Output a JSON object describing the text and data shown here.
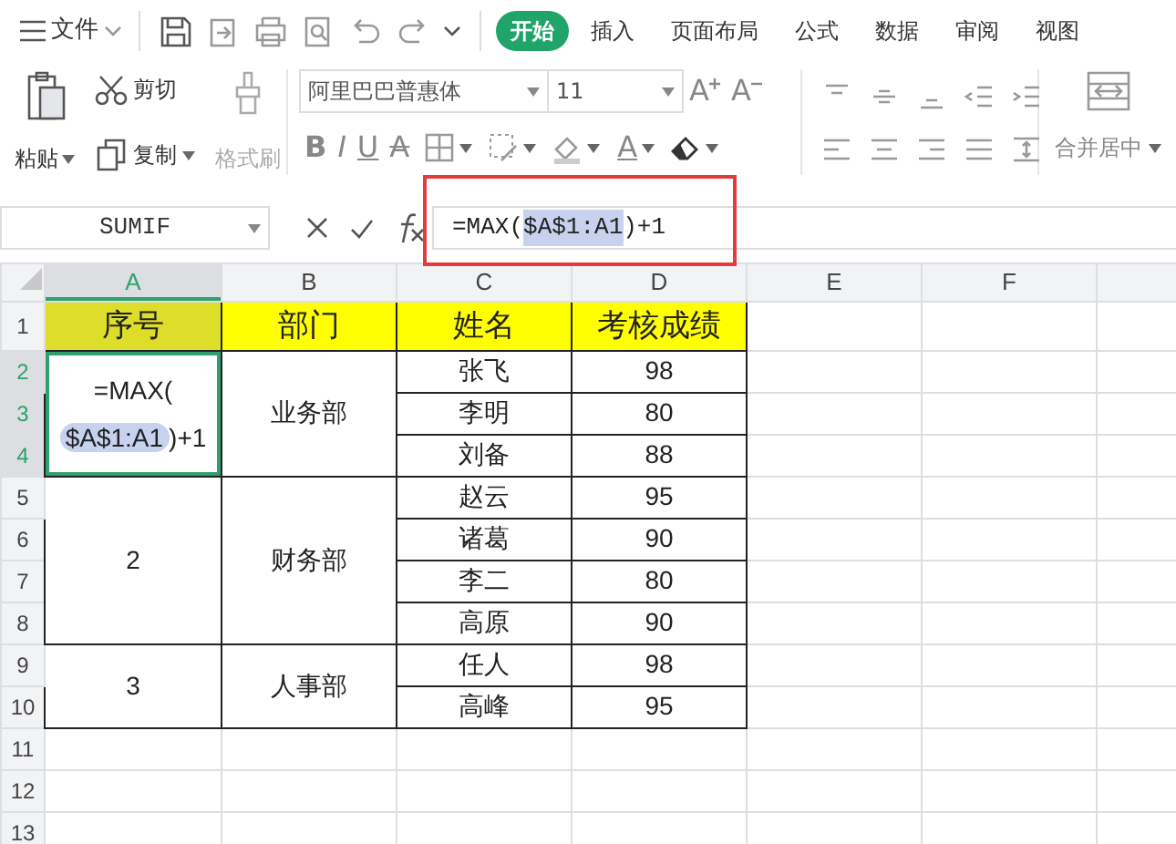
{
  "app_menu": {
    "label": "文件"
  },
  "tabs": [
    {
      "label": "开始",
      "selected": true
    },
    {
      "label": "插入",
      "selected": false
    },
    {
      "label": "页面布局",
      "selected": false
    },
    {
      "label": "公式",
      "selected": false
    },
    {
      "label": "数据",
      "selected": false
    },
    {
      "label": "审阅",
      "selected": false
    },
    {
      "label": "视图",
      "selected": false
    }
  ],
  "clipboard": {
    "paste": "粘贴",
    "cut": "剪切",
    "copy": "复制",
    "format_painter": {
      "label": "格式刷",
      "disabled": true
    }
  },
  "font": {
    "name": "阿里巴巴普惠体",
    "size": "11"
  },
  "font_size_buttons": [
    {
      "kind": "grow",
      "glyph": "A"
    },
    {
      "kind": "shrink",
      "glyph": "A"
    }
  ],
  "style_buttons": [
    {
      "kind": "bold",
      "glyph": "B"
    },
    {
      "kind": "italic",
      "glyph": "I"
    },
    {
      "kind": "underline",
      "glyph": "U"
    },
    {
      "kind": "strike",
      "glyph": "A"
    }
  ],
  "font_color": {
    "glyph": "A"
  },
  "merge": {
    "label": "合并居中"
  },
  "formula_bar": {
    "name_box": "SUMIF",
    "formula": {
      "before": "=MAX(",
      "reference": "$A$1:A1",
      "after": ")+1"
    },
    "highlighted": true
  },
  "columns": [
    {
      "label": "A",
      "selected": true
    },
    {
      "label": "B",
      "selected": false
    },
    {
      "label": "C",
      "selected": false
    },
    {
      "label": "D",
      "selected": false
    },
    {
      "label": "E",
      "selected": false
    },
    {
      "label": "F",
      "selected": false
    }
  ],
  "row_numbers": [
    {
      "label": "1",
      "selected": false
    },
    {
      "label": "2",
      "selected": true
    },
    {
      "label": "3",
      "selected": true
    },
    {
      "label": "4",
      "selected": true
    },
    {
      "label": "5",
      "selected": false
    },
    {
      "label": "6",
      "selected": false
    },
    {
      "label": "7",
      "selected": false
    },
    {
      "label": "8",
      "selected": false
    },
    {
      "label": "9",
      "selected": false
    },
    {
      "label": "10",
      "selected": false
    },
    {
      "label": "11",
      "selected": false
    },
    {
      "label": "12",
      "selected": false
    },
    {
      "label": "13",
      "selected": false
    }
  ],
  "table": {
    "headers": [
      {
        "text": "序号",
        "referenced": true
      },
      {
        "text": "部门",
        "referenced": false
      },
      {
        "text": "姓名",
        "referenced": false
      },
      {
        "text": "考核成绩",
        "referenced": false
      }
    ],
    "groups": [
      {
        "seq": {
          "kind": "editing",
          "before": "=MAX(",
          "reference": "$A$1:A1",
          "after": ")+1",
          "selected": true
        },
        "department": "业务部",
        "people": [
          {
            "name": "张飞",
            "score": "98"
          },
          {
            "name": "李明",
            "score": "80"
          },
          {
            "name": "刘备",
            "score": "88"
          }
        ]
      },
      {
        "seq": {
          "kind": "value",
          "text": "2",
          "selected": false
        },
        "department": "财务部",
        "people": [
          {
            "name": "赵云",
            "score": "95"
          },
          {
            "name": "诸葛",
            "score": "90"
          },
          {
            "name": "李二",
            "score": "80"
          },
          {
            "name": "高原",
            "score": "90"
          }
        ]
      },
      {
        "seq": {
          "kind": "value",
          "text": "3",
          "selected": false
        },
        "department": "人事部",
        "people": [
          {
            "name": "任人",
            "score": "98"
          },
          {
            "name": "高峰",
            "score": "95"
          }
        ]
      }
    ]
  }
}
